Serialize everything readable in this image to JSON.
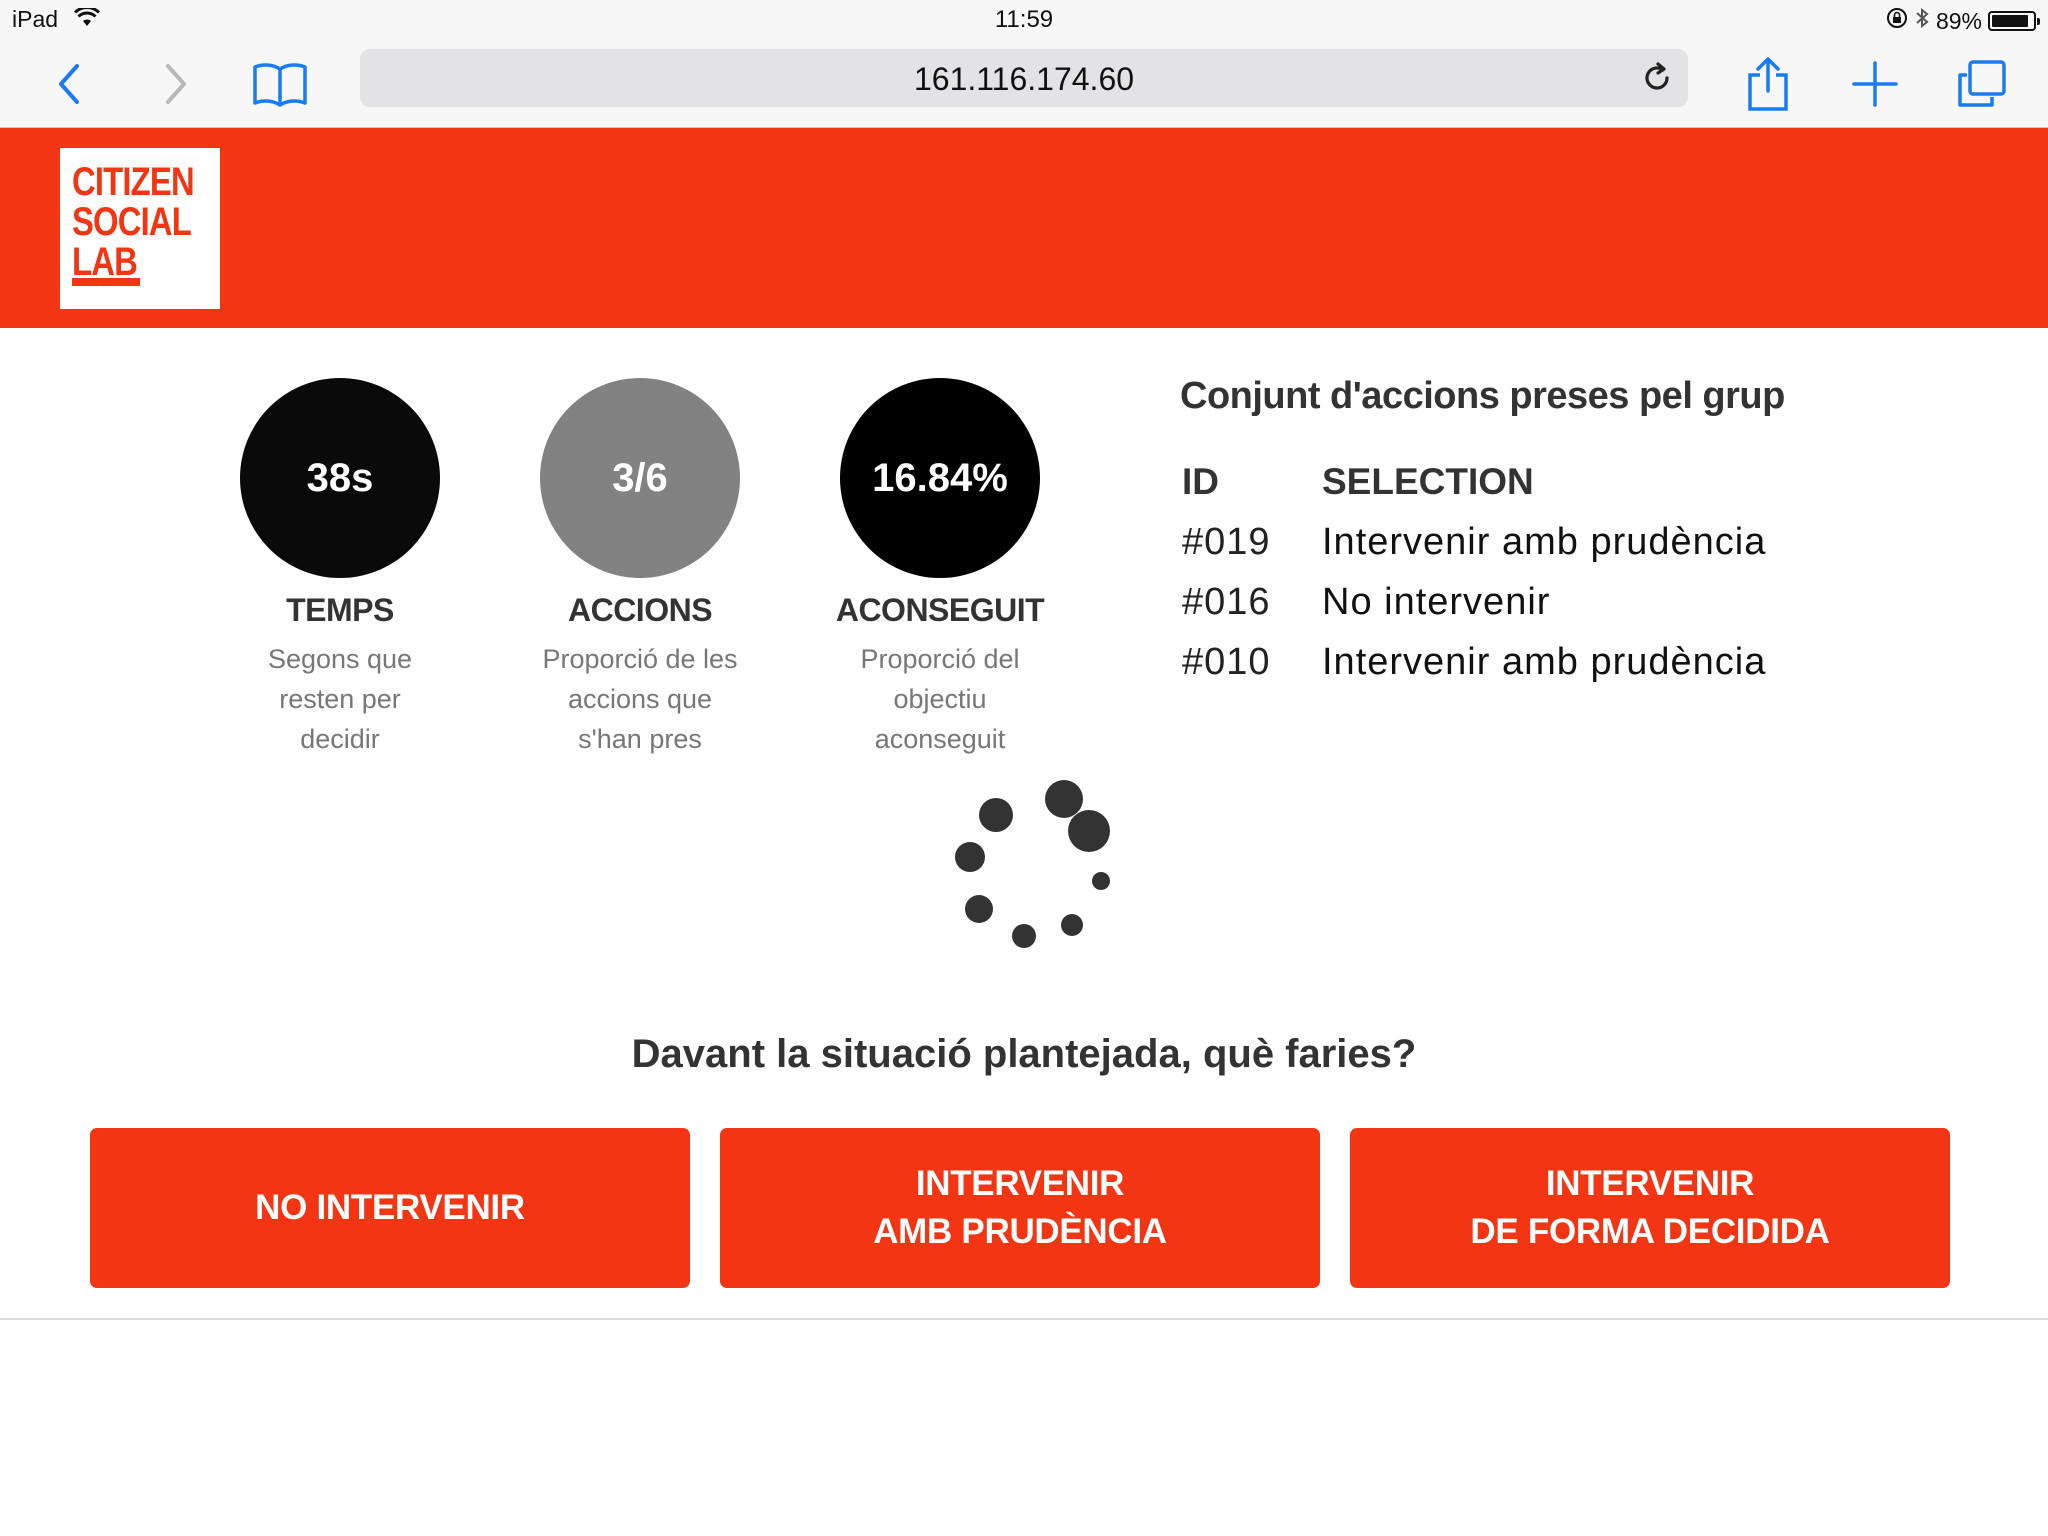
{
  "status_bar": {
    "device": "iPad",
    "time": "11:59",
    "battery": "89%",
    "battery_level": 0.89
  },
  "browser": {
    "url": "161.116.174.60"
  },
  "logo": {
    "line1": "CITIZEN",
    "line2": "SOCIAL",
    "line3": "LAB"
  },
  "stats": [
    {
      "value": "38s",
      "title": "TEMPS",
      "desc": [
        "Segons que",
        "resten per",
        "decidir"
      ],
      "color": "#0a0a0a"
    },
    {
      "value": "3/6",
      "title": "ACCIONS",
      "desc": [
        "Proporció de les",
        "accions que",
        "s'han pres"
      ],
      "color": "#828282"
    },
    {
      "value": "16.84%",
      "title": "ACONSEGUIT",
      "desc": [
        "Proporció del",
        "objectiu",
        "aconseguit"
      ],
      "color": "#000000"
    }
  ],
  "actions": {
    "title": "Conjunt d'accions preses pel grup",
    "header": {
      "id": "ID",
      "selection": "SELECTION"
    },
    "rows": [
      {
        "id": "#019",
        "selection": "Intervenir amb prudència"
      },
      {
        "id": "#016",
        "selection": "No intervenir"
      },
      {
        "id": "#010",
        "selection": "Intervenir amb prudència"
      }
    ]
  },
  "question": "Davant la situació plantejada, què faries?",
  "choices": [
    {
      "line1": "NO INTERVENIR",
      "line2": ""
    },
    {
      "line1": "INTERVENIR",
      "line2": "AMB PRUDÈNCIA"
    },
    {
      "line1": "INTERVENIR",
      "line2": "DE FORMA DECIDIDA"
    }
  ],
  "colors": {
    "accent": "#f43514",
    "ios_blue": "#1a7cf4"
  }
}
